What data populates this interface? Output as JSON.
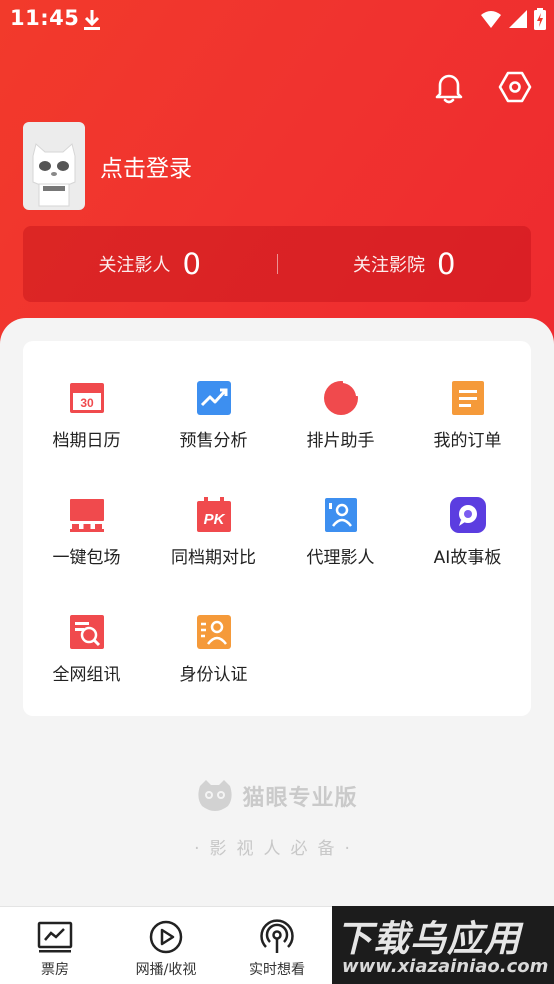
{
  "status_bar": {
    "time": "11:45"
  },
  "profile": {
    "login_text": "点击登录"
  },
  "follow": [
    {
      "label": "关注影人",
      "count": "0"
    },
    {
      "label": "关注影院",
      "count": "0"
    }
  ],
  "grid": [
    {
      "label": "档期日历",
      "icon": "calendar-icon",
      "badge": "30"
    },
    {
      "label": "预售分析",
      "icon": "trend-chart-icon"
    },
    {
      "label": "排片助手",
      "icon": "pie-chart-icon"
    },
    {
      "label": "我的订单",
      "icon": "order-list-icon"
    },
    {
      "label": "一键包场",
      "icon": "cinema-screen-icon"
    },
    {
      "label": "同档期对比",
      "icon": "pk-compare-icon",
      "badge": "PK"
    },
    {
      "label": "代理影人",
      "icon": "agent-person-icon"
    },
    {
      "label": "AI故事板",
      "icon": "ai-chat-icon"
    },
    {
      "label": "全网组讯",
      "icon": "search-news-icon"
    },
    {
      "label": "身份认证",
      "icon": "identity-verify-icon"
    }
  ],
  "brand": {
    "name": "猫眼专业版",
    "slogan": "·影视人必备·"
  },
  "tabs": [
    {
      "label": "票房",
      "icon": "box-office-icon"
    },
    {
      "label": "网播/收视",
      "icon": "play-icon"
    },
    {
      "label": "实时想看",
      "icon": "broadcast-icon"
    }
  ],
  "watermark": {
    "title": "下载乌应用",
    "url": "www.xiazainiao.com"
  },
  "colors": {
    "header_red": "#f0332f",
    "icon_red": "#f04a4d",
    "icon_blue": "#3d8ff0",
    "icon_orange": "#f59a3a",
    "icon_purple": "#5b3de0"
  }
}
